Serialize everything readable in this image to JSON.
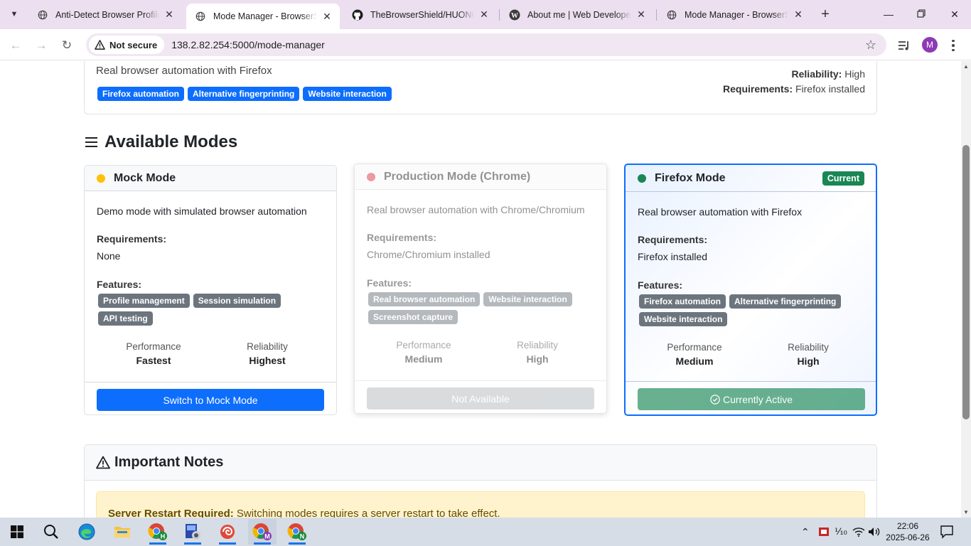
{
  "browser": {
    "tabs": [
      {
        "title": "Anti-Detect Browser Profile M",
        "active": false,
        "icon": "chrome-globe-icon"
      },
      {
        "title": "Mode Manager - BrowserShield",
        "active": true,
        "icon": "chrome-globe-icon"
      },
      {
        "title": "TheBrowserShield/HUONG_DA",
        "active": false,
        "icon": "github-icon"
      },
      {
        "title": "About me | Web Developer & D",
        "active": false,
        "icon": "wordpress-icon"
      },
      {
        "title": "Mode Manager - BrowserShield",
        "active": false,
        "icon": "chrome-globe-icon"
      }
    ],
    "security_label": "Not secure",
    "url": "138.2.82.254:5000/mode-manager",
    "profile_initial": "M"
  },
  "current_mode_summary": {
    "description": "Real browser automation with Firefox",
    "features": [
      "Firefox automation",
      "Alternative fingerprinting",
      "Website interaction"
    ],
    "reliability_label": "Reliability:",
    "reliability_value": "High",
    "requirements_label": "Requirements:",
    "requirements_value": "Firefox installed"
  },
  "available_modes": {
    "title": "Available Modes",
    "modes": [
      {
        "name": "Mock Mode",
        "status_color": "#ffc107",
        "description": "Demo mode with simulated browser automation",
        "requirements_label": "Requirements:",
        "requirements": "None",
        "features_label": "Features:",
        "features": [
          "Profile management",
          "Session simulation",
          "API testing"
        ],
        "performance_label": "Performance",
        "performance": "Fastest",
        "reliability_label": "Reliability",
        "reliability": "Highest",
        "action_label": "Switch to Mock Mode",
        "state": "available"
      },
      {
        "name": "Production Mode (Chrome)",
        "status_color": "#dc3545",
        "description": "Real browser automation with Chrome/Chromium",
        "requirements_label": "Requirements:",
        "requirements": "Chrome/Chromium installed",
        "features_label": "Features:",
        "features": [
          "Real browser automation",
          "Website interaction",
          "Screenshot capture"
        ],
        "performance_label": "Performance",
        "performance": "Medium",
        "reliability_label": "Reliability",
        "reliability": "High",
        "action_label": "Not Available",
        "state": "unavailable"
      },
      {
        "name": "Firefox Mode",
        "status_color": "#198754",
        "badge": "Current",
        "description": "Real browser automation with Firefox",
        "requirements_label": "Requirements:",
        "requirements": "Firefox installed",
        "features_label": "Features:",
        "features": [
          "Firefox automation",
          "Alternative fingerprinting",
          "Website interaction"
        ],
        "performance_label": "Performance",
        "performance": "Medium",
        "reliability_label": "Reliability",
        "reliability": "High",
        "action_label": "Currently Active",
        "state": "active"
      }
    ]
  },
  "notes": {
    "title": "Important Notes",
    "alert_title": "Server Restart Required:",
    "alert_text": " Switching modes requires a server restart to take effect."
  },
  "taskbar": {
    "time": "22:06",
    "date": "2025-06-26",
    "apps": [
      "windows-start-icon",
      "search-icon",
      "edge-icon",
      "file-explorer-icon",
      "chrome-h-profile-icon",
      "network-tool-icon",
      "app-swirl-icon",
      "chrome-m-profile-icon",
      "chrome-n-profile-icon"
    ]
  },
  "colors": {
    "primary": "#0d6efd",
    "secondary": "#6c757d",
    "success": "#198754",
    "warning_bg": "#fff3cd",
    "tabstrip_bg": "#ecdfef"
  }
}
